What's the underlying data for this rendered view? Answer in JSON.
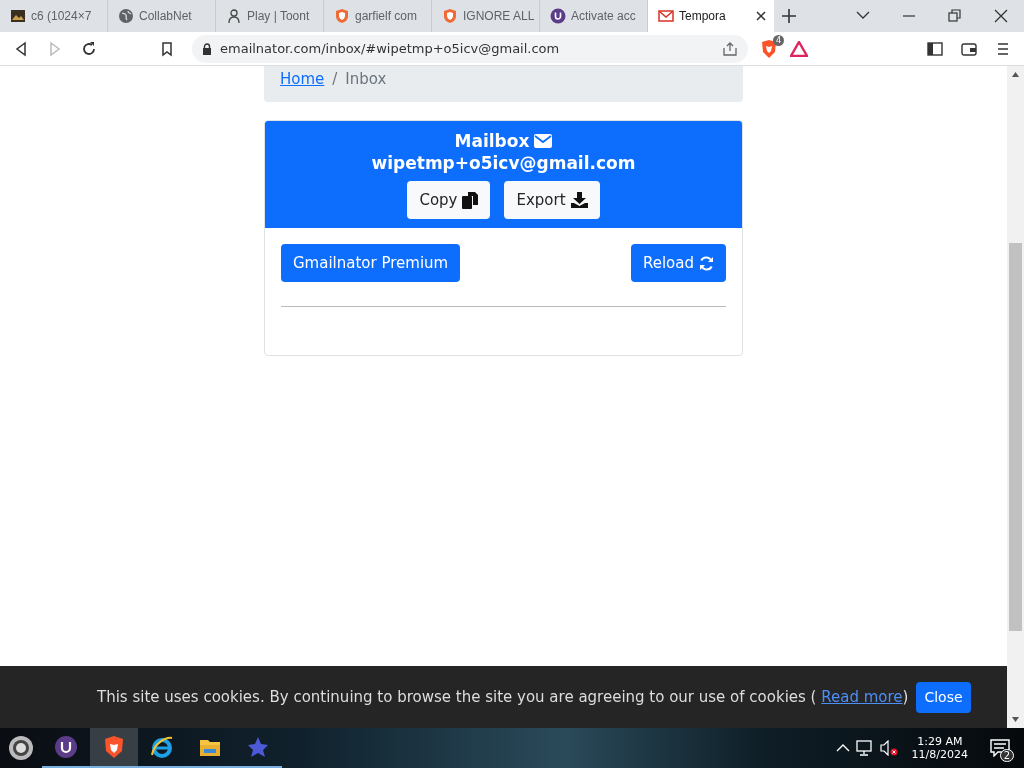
{
  "browser": {
    "tabs": [
      {
        "title": "c6 (1024×7",
        "kind": "image",
        "selected": false
      },
      {
        "title": "CollabNet",
        "kind": "globe",
        "selected": false
      },
      {
        "title": "Play | Toont",
        "kind": "toon",
        "selected": false
      },
      {
        "title": "garfielf com",
        "kind": "shield",
        "selected": false
      },
      {
        "title": "IGNORE ALL",
        "kind": "shield",
        "selected": false
      },
      {
        "title": "Activate acc",
        "kind": "u",
        "selected": false
      },
      {
        "title": "Tempora",
        "kind": "mail",
        "selected": true
      }
    ],
    "address": "emailnator.com/inbox/#wipetmp+o5icv@gmail.com",
    "shield_badge": "4"
  },
  "page": {
    "breadcrumb": [
      {
        "label": "Home",
        "kind": "link"
      },
      {
        "label": "Inbox",
        "kind": "current"
      }
    ],
    "separator": "/",
    "mailbox": {
      "title": "Mailbox",
      "address": "wipetmp+o5icv@gmail.com",
      "buttons": [
        {
          "label": "Copy",
          "kind": "copy"
        },
        {
          "label": "Export",
          "kind": "download"
        }
      ]
    },
    "actions": [
      {
        "label": "Gmailnator Premium",
        "kind": "plain"
      },
      {
        "label": "Reload",
        "kind": "sync"
      }
    ]
  },
  "cookie_bar": {
    "text": "This site uses cookies. By continuing to browse the site you are agreeing to our use of cookies (",
    "link": "Read more",
    "after": ")",
    "button": "Close"
  },
  "taskbar": {
    "apps": [
      {
        "kind": "u",
        "active": false
      },
      {
        "kind": "brave",
        "active": true
      },
      {
        "kind": "ie",
        "active": false
      },
      {
        "kind": "folder",
        "active": false
      },
      {
        "kind": "star",
        "active": false
      }
    ],
    "time": "1:29 AM",
    "date": "11/8/2024",
    "notifications": "2"
  }
}
